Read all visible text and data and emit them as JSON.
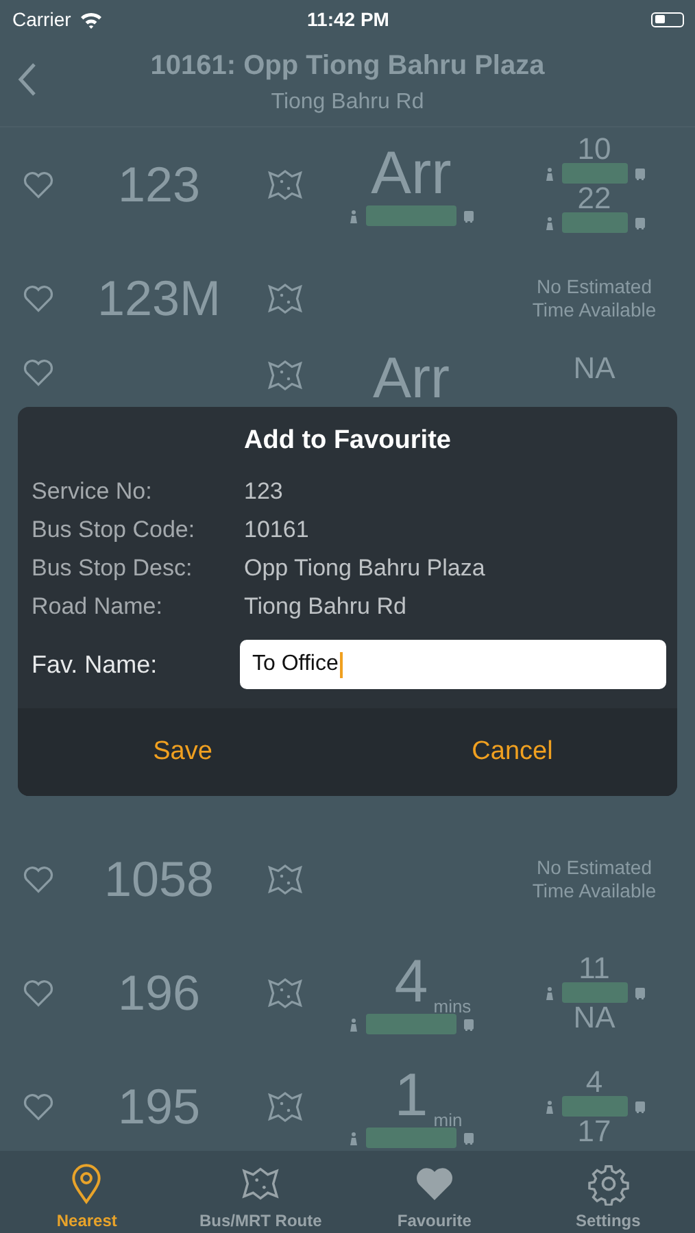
{
  "status_bar": {
    "carrier": "Carrier",
    "time": "11:42 PM"
  },
  "nav": {
    "title": "10161: Opp Tiong Bahru Plaza",
    "subtitle": "Tiong Bahru Rd"
  },
  "rows_top": [
    {
      "service": "123",
      "kind": "times",
      "main": {
        "time": "Arr",
        "load": true
      },
      "next": [
        {
          "time": "10",
          "load": true
        },
        {
          "time": "22",
          "load": true
        }
      ]
    },
    {
      "service": "123M",
      "kind": "none",
      "note": "No Estimated Time Available"
    },
    {
      "kind": "times",
      "main": {
        "time": "Arr"
      },
      "next": [
        {
          "time": "NA"
        }
      ]
    }
  ],
  "rows_bottom": [
    {
      "service": "1058",
      "kind": "none",
      "note": "No Estimated Time Available"
    },
    {
      "service": "196",
      "kind": "times",
      "main": {
        "time": "4",
        "unit": "mins",
        "load": true
      },
      "next": [
        {
          "time": "11",
          "load": true
        },
        {
          "time": "NA",
          "load": false
        }
      ]
    },
    {
      "service": "195",
      "kind": "times",
      "main": {
        "time": "1",
        "unit": "min",
        "load": true
      },
      "next": [
        {
          "time": "4",
          "load": true
        },
        {
          "time": "17",
          "load": false
        }
      ]
    }
  ],
  "dialog": {
    "title": "Add to Favourite",
    "fields": [
      {
        "label": "Service No:",
        "value": "123"
      },
      {
        "label": "Bus Stop Code:",
        "value": "10161"
      },
      {
        "label": "Bus Stop Desc:",
        "value": "Opp Tiong Bahru Plaza"
      },
      {
        "label": "Road Name:",
        "value": "Tiong Bahru Rd"
      }
    ],
    "fav": {
      "label": "Fav. Name:",
      "value": "To Office"
    },
    "buttons": [
      "Save",
      "Cancel"
    ]
  },
  "tabs": [
    {
      "label": "Nearest",
      "selected": true
    },
    {
      "label": "Bus/MRT Route",
      "selected": false
    },
    {
      "label": "Favourite",
      "selected": false
    },
    {
      "label": "Settings",
      "selected": false
    }
  ]
}
